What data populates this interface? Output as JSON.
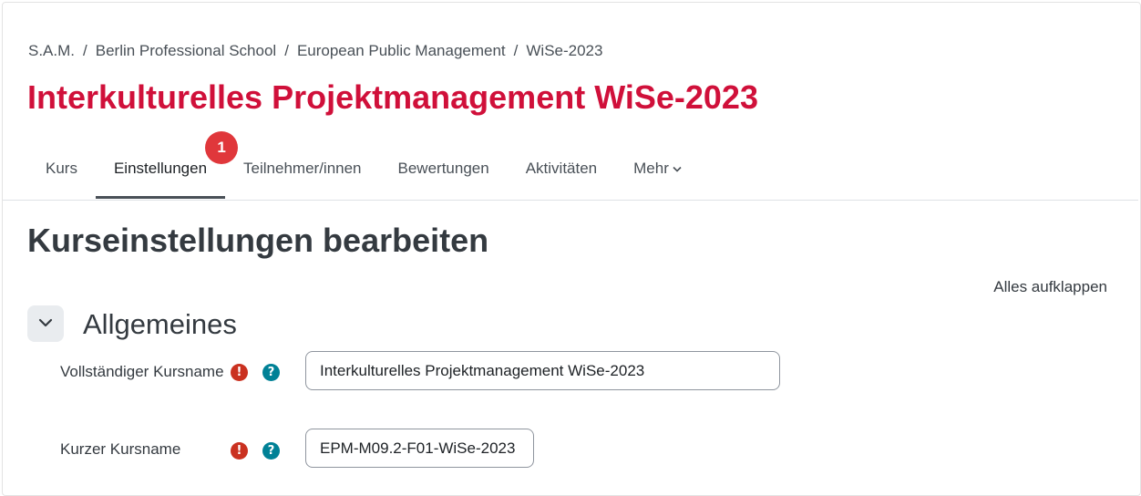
{
  "breadcrumb": [
    "S.A.M.",
    "Berlin Professional School",
    "European Public Management",
    "WiSe-2023"
  ],
  "breadcrumb_separator": "/",
  "course_title": "Interkulturelles Projektmanagement WiSe-2023",
  "tabs": [
    {
      "label": "Kurs"
    },
    {
      "label": "Einstellungen",
      "active": true,
      "badge": "1"
    },
    {
      "label": "Teilnehmer/innen"
    },
    {
      "label": "Bewertungen"
    },
    {
      "label": "Aktivitäten"
    },
    {
      "label": "Mehr",
      "icon": "chevron-down-icon"
    }
  ],
  "page_heading": "Kurseinstellungen bearbeiten",
  "expand_all": "Alles aufklappen",
  "section": {
    "title": "Allgemeines",
    "toggle_icon": "chevron-down-icon"
  },
  "fields": [
    {
      "label": "Vollständiger Kursname",
      "value": "Interkulturelles Projektmanagement WiSe-2023",
      "required_icon": "exclamation-icon",
      "help_icon": "question-icon"
    },
    {
      "label": "Kurzer Kursname",
      "value": "EPM-M09.2-F01-WiSe-2023",
      "required_icon": "exclamation-icon",
      "help_icon": "question-icon"
    }
  ],
  "colors": {
    "brand": "#d0103a",
    "badge": "#e0373b",
    "required": "#ca3120",
    "help": "#008196"
  }
}
